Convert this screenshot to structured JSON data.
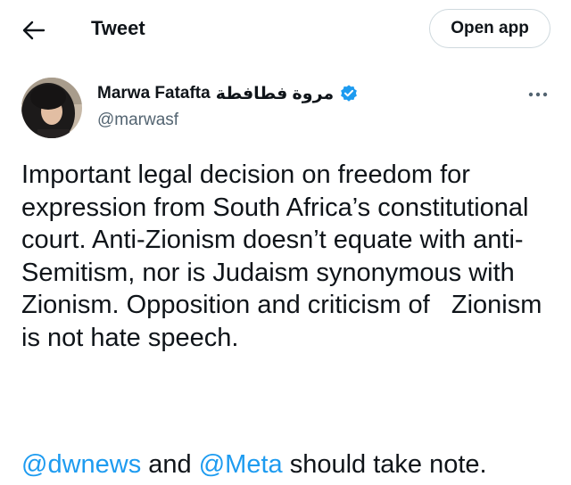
{
  "header": {
    "title": "Tweet",
    "open_app_label": "Open app"
  },
  "author": {
    "display_name": "Marwa Fatafta",
    "display_name_arabic": "مروة فطافطة",
    "handle": "@marwasf",
    "verified": true
  },
  "tweet": {
    "text": "Important legal decision on freedom for expression from South Africa’s constitutional court. Anti-Zionism doesn’t equate with anti-Semitism, nor is Judaism synonymous with Zionism. Opposition and criticism of   Zionism is not hate speech.",
    "mention_1": "@dwnews",
    "connector": " and ",
    "mention_2": "@Meta",
    "closing": " should take note."
  },
  "colors": {
    "accent": "#1d9bf0",
    "text": "#0f1419",
    "secondary": "#536471",
    "border": "#cfd9de"
  },
  "icons": {
    "back": "arrow-left-icon",
    "verified": "verified-badge-icon",
    "more": "more-horizontal-icon"
  }
}
